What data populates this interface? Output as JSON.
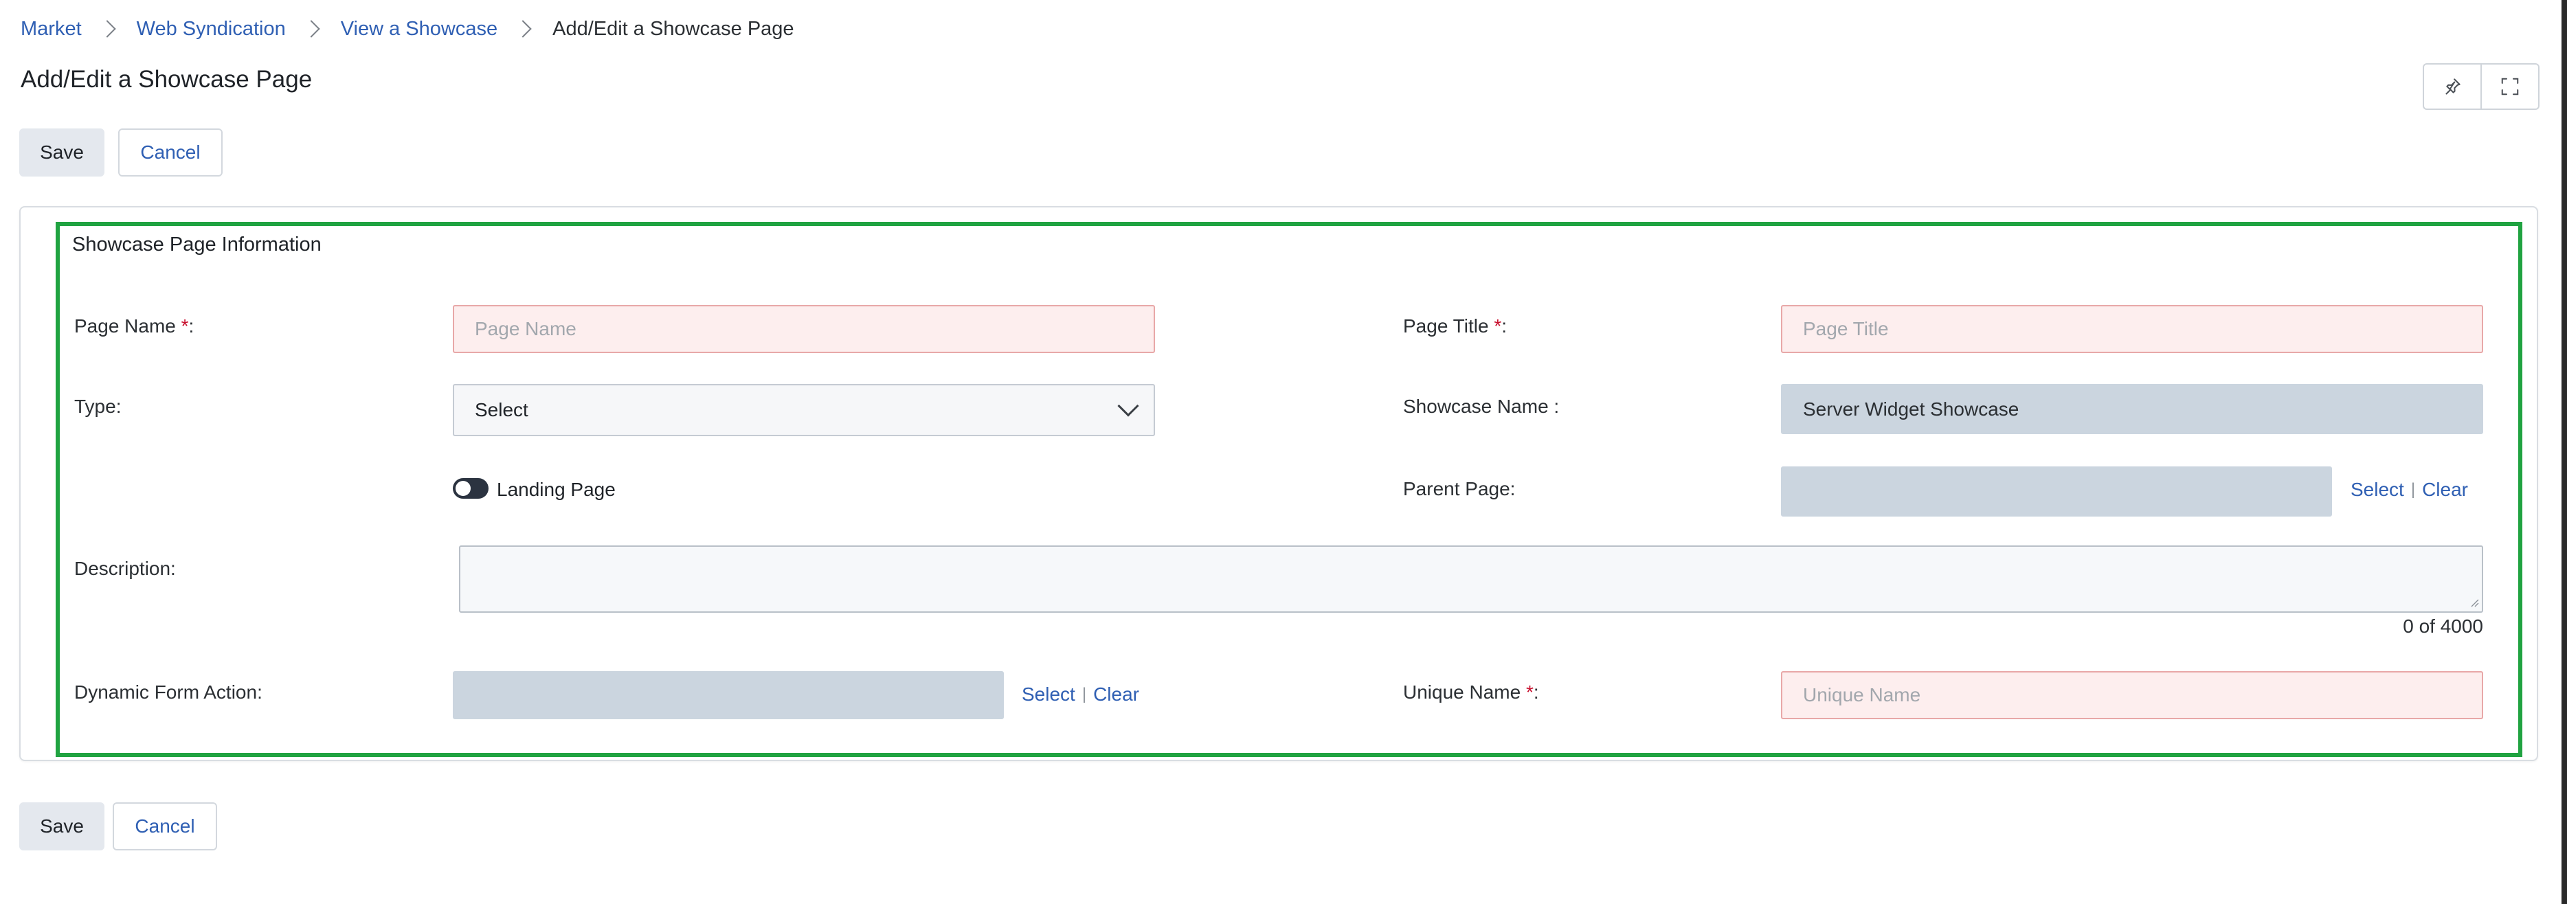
{
  "breadcrumb": {
    "items": [
      "Market",
      "Web Syndication",
      "View a Showcase"
    ],
    "current": "Add/Edit a Showcase Page"
  },
  "page": {
    "title": "Add/Edit a Showcase Page"
  },
  "toolbar_top": {
    "save_label": "Save",
    "cancel_label": "Cancel",
    "icons": [
      "pin-icon",
      "fullscreen-icon"
    ]
  },
  "toolbar_bottom": {
    "save_label": "Save",
    "cancel_label": "Cancel"
  },
  "section": {
    "title": "Showcase Page Information",
    "page_name": {
      "label": "Page Name ",
      "required": "*",
      "suffix": ":",
      "placeholder": "Page Name",
      "value": ""
    },
    "page_title": {
      "label": "Page Title ",
      "required": "*",
      "suffix": ":",
      "placeholder": "Page Title",
      "value": ""
    },
    "type": {
      "label": "Type:",
      "selected": "Select"
    },
    "showcase_name": {
      "label": "Showcase Name :",
      "value": "Server Widget Showcase"
    },
    "landing_page": {
      "label": "Landing Page",
      "on": false
    },
    "parent_page": {
      "label": "Parent Page:",
      "value": "",
      "select_label": "Select",
      "separator": "|",
      "clear_label": "Clear"
    },
    "description": {
      "label": "Description:",
      "value": "",
      "counter": "0 of 4000"
    },
    "dynamic_form_action": {
      "label": "Dynamic Form Action:",
      "value": "",
      "select_label": "Select",
      "separator": "|",
      "clear_label": "Clear"
    },
    "unique_name": {
      "label": "Unique Name ",
      "required": "*",
      "suffix": ":",
      "placeholder": "Unique Name",
      "value": ""
    }
  },
  "colors": {
    "link": "#2f5fb3",
    "required_field_bg": "#fdeeee",
    "required_field_border": "#e8a8a8",
    "readonly_field_bg": "#cbd5df",
    "highlight_border": "#20a341",
    "required_marker": "#c8102e"
  }
}
